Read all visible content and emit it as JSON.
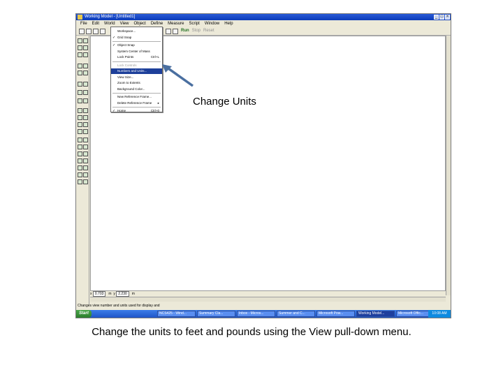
{
  "window": {
    "title": "Working Model - [Untitled1]",
    "menus": [
      "File",
      "Edit",
      "World",
      "View",
      "Object",
      "Define",
      "Measure",
      "Script",
      "Window",
      "Help"
    ],
    "toolbar": {
      "run_label": "Run",
      "stop_label": "Stop",
      "reset_label": "Reset"
    }
  },
  "view_menu": {
    "items": [
      {
        "label": "Workspace...",
        "shortcut": "",
        "checked": false,
        "disabled": false,
        "highlight": false
      },
      {
        "label": "Grid Snap",
        "shortcut": "",
        "checked": true,
        "disabled": false,
        "highlight": false
      },
      {
        "label": "Object Snap",
        "shortcut": "",
        "checked": true,
        "disabled": false,
        "highlight": false
      },
      {
        "label": "System Center of Mass",
        "shortcut": "",
        "checked": false,
        "disabled": false,
        "highlight": false
      },
      {
        "label": "Lock Points",
        "shortcut": "Ctrl+L",
        "checked": false,
        "disabled": false,
        "highlight": false
      },
      {
        "label": "Lock Controls",
        "shortcut": "",
        "checked": false,
        "disabled": true,
        "highlight": false
      },
      {
        "label": "Numbers and Units...",
        "shortcut": "",
        "checked": false,
        "disabled": false,
        "highlight": true
      },
      {
        "label": "View Size...",
        "shortcut": "",
        "checked": false,
        "disabled": false,
        "highlight": false
      },
      {
        "label": "Zoom to Extents",
        "shortcut": "",
        "checked": false,
        "disabled": false,
        "highlight": false
      },
      {
        "label": "Background Color...",
        "shortcut": "",
        "checked": false,
        "disabled": false,
        "highlight": false
      },
      {
        "label": "New Reference Frame...",
        "shortcut": "",
        "checked": false,
        "disabled": false,
        "highlight": false
      },
      {
        "label": "Delete Reference Frame",
        "shortcut": "▸",
        "checked": false,
        "disabled": false,
        "highlight": false
      },
      {
        "label": "Home",
        "shortcut": "Ctrl+0",
        "checked": true,
        "disabled": false,
        "highlight": false
      }
    ]
  },
  "coords": {
    "x_value": "0.703",
    "x_unit": "m",
    "y_value": "2.230",
    "y_unit": "m"
  },
  "status_text": "Changes view number and units used for display and",
  "taskbar": {
    "start_label": "Start",
    "tasks": [
      "NCS425 - Wind...",
      "Summary Cla...",
      "Inbox - Micros...",
      "Summer and C...",
      "Microsoft Pow...",
      "Working Model...",
      "Microsoft Offic..."
    ],
    "active_task_index": 5,
    "clock": "10:08 AM"
  },
  "annotation": {
    "label": "Change Units",
    "arrow_color": "#4a6fa0"
  },
  "caption": "Change the units to feet and pounds using the View pull-down menu."
}
